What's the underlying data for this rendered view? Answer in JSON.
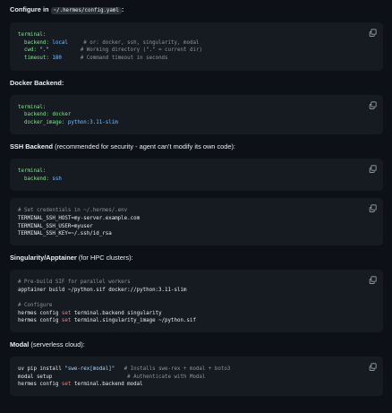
{
  "s1": {
    "intro_text": "Configure in",
    "intro_code": "~/.hermes/config.yaml",
    "intro_suffix": ":",
    "code": [
      [
        [
          "terminal:",
          "key"
        ]
      ],
      [
        [
          "  backend: ",
          "key"
        ],
        [
          "local",
          "val"
        ],
        [
          "     # or: docker, ssh, singularity, modal",
          "cmt"
        ]
      ],
      [
        [
          "  cwd: ",
          "key"
        ],
        [
          "\".\"",
          "str"
        ],
        [
          "          # Working directory (\".\" = current dir)",
          "cmt"
        ]
      ],
      [
        [
          "  timeout: ",
          "key"
        ],
        [
          "180",
          "val"
        ],
        [
          "      # Command timeout in seconds",
          "cmt"
        ]
      ]
    ]
  },
  "s2": {
    "heading": "Docker Backend:",
    "code": [
      [
        [
          "terminal:",
          "key"
        ]
      ],
      [
        [
          "  backend: ",
          "key"
        ],
        [
          "docker",
          "key"
        ]
      ],
      [
        [
          "  docker_image: ",
          "key"
        ],
        [
          "python:3.11-slim",
          "val"
        ]
      ]
    ]
  },
  "s3": {
    "heading_bold": "SSH Backend",
    "heading_rest": " (recommended for security - agent can't modify its own code):",
    "code1": [
      [
        [
          "terminal:",
          "key"
        ]
      ],
      [
        [
          "  backend: ",
          "key"
        ],
        [
          "ssh",
          "val"
        ]
      ]
    ],
    "code2": [
      [
        [
          "# Set credentials in ~/.hermes/.env",
          "cmt"
        ]
      ],
      [
        [
          "TERMINAL_SSH_HOST=my-server.example.com",
          "plain"
        ]
      ],
      [
        [
          "TERMINAL_SSH_USER=myuser",
          "plain"
        ]
      ],
      [
        [
          "TERMINAL_SSH_KEY=~/.ssh/id_rsa",
          "plain"
        ]
      ]
    ]
  },
  "s4": {
    "heading_bold": "Singularity/Apptainer",
    "heading_rest": " (for HPC clusters):",
    "code": [
      [
        [
          "# Pre-build SIF for parallel workers",
          "cmt"
        ]
      ],
      [
        [
          "apptainer build ~/python.sif docker://python:3.11-slim",
          "plain"
        ]
      ],
      [
        [
          "",
          "plain"
        ]
      ],
      [
        [
          "# Configure",
          "cmt"
        ]
      ],
      [
        [
          "hermes config ",
          "plain"
        ],
        [
          "set",
          "set"
        ],
        [
          " terminal.backend singularity",
          "plain"
        ]
      ],
      [
        [
          "hermes config ",
          "plain"
        ],
        [
          "set",
          "set"
        ],
        [
          " terminal.singularity_image ~/python.sif",
          "plain"
        ]
      ]
    ]
  },
  "s5": {
    "heading_bold": "Modal",
    "heading_rest": " (serverless cloud):",
    "code": [
      [
        [
          "uv pip install ",
          "plain"
        ],
        [
          "\"swe-rex[modal]\"",
          "str"
        ],
        [
          "   # Installs swe-rex + modal + boto3",
          "cmt"
        ]
      ],
      [
        [
          "modal setup",
          "plain"
        ],
        [
          "                        # Authenticate with Modal",
          "cmt"
        ]
      ],
      [
        [
          "hermes config ",
          "plain"
        ],
        [
          "set",
          "set"
        ],
        [
          " terminal.backend modal",
          "plain"
        ]
      ]
    ]
  },
  "icons": {
    "copy": "copy-icon"
  },
  "colors": {
    "background": "#0d1117",
    "block": "#161b22",
    "key": "#7ee787",
    "value": "#79c0ff",
    "comment": "#8b949e",
    "keyword": "#ff7b72"
  }
}
